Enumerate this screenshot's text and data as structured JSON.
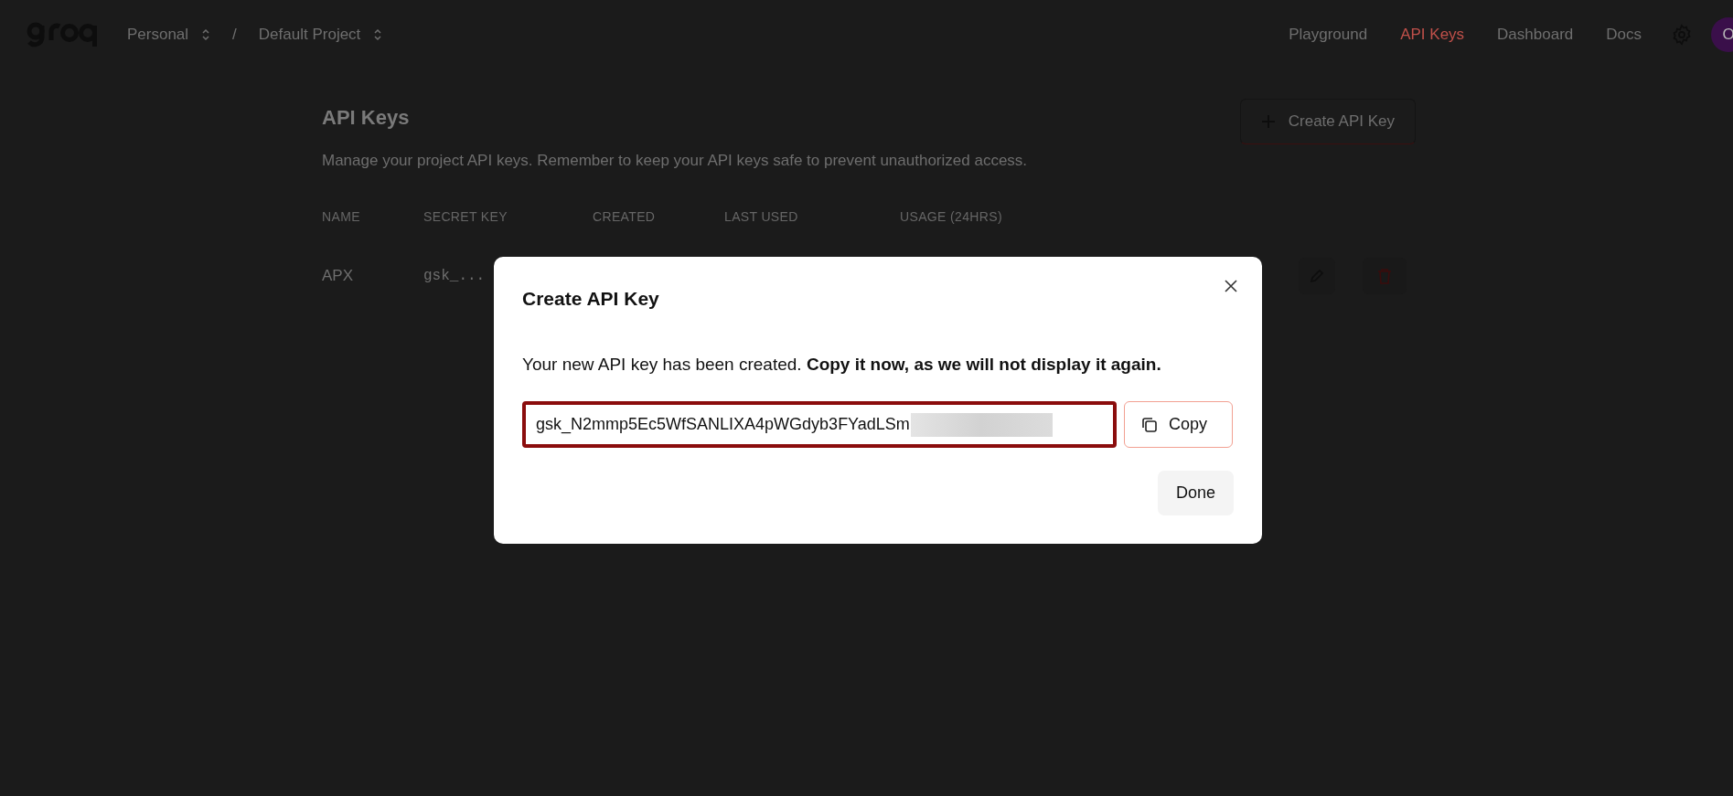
{
  "header": {
    "breadcrumbs": [
      {
        "label": "Personal"
      },
      {
        "label": "Default Project"
      }
    ],
    "separator": "/",
    "nav": [
      {
        "label": "Playground",
        "selected": false
      },
      {
        "label": "API Keys",
        "selected": true
      },
      {
        "label": "Dashboard",
        "selected": false
      },
      {
        "label": "Docs",
        "selected": false
      }
    ],
    "avatar": "O"
  },
  "page": {
    "title": "API Keys",
    "description": "Manage your project API keys. Remember to keep your API keys safe to prevent unauthorized access.",
    "create_button": "Create API Key",
    "table": {
      "columns": [
        "NAME",
        "SECRET KEY",
        "CREATED",
        "LAST USED",
        "USAGE (24HRS)"
      ],
      "rows": [
        {
          "name": "APX",
          "secret_key": "gsk_..."
        }
      ]
    }
  },
  "dialog": {
    "title": "Create API Key",
    "message": "Your new API key has been created. **Copy it now, as we will not display it again.**",
    "key_value": "gsk_N2mmp5Ec5WfSANLIXA4pWGdyb3FYadLSm",
    "redacted": true,
    "copy_button": "Copy",
    "done_button": "Done"
  }
}
